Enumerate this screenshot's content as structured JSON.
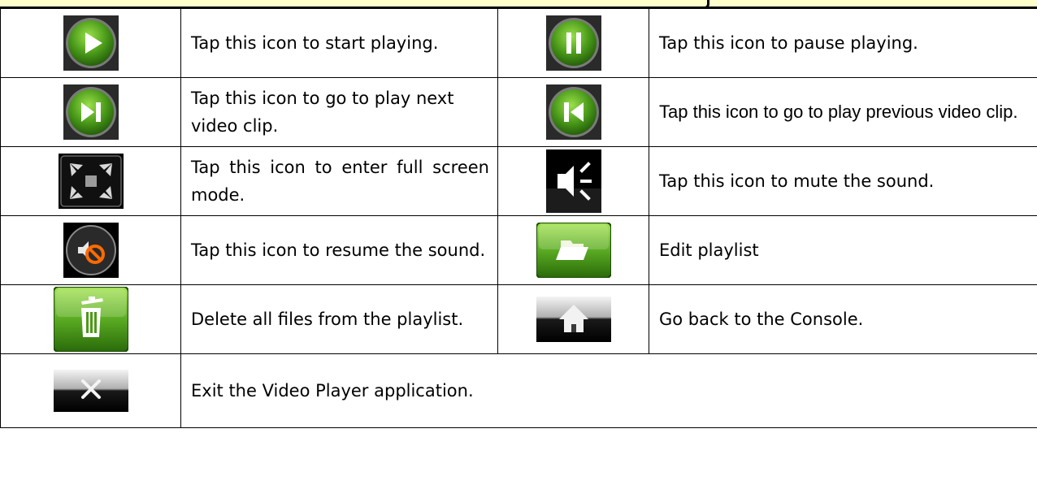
{
  "rows": [
    {
      "left": {
        "icon": "play-icon",
        "text": "Tap this icon to start playing."
      },
      "right": {
        "icon": "pause-icon",
        "text": "Tap this icon to pause playing."
      }
    },
    {
      "left": {
        "icon": "next-clip-icon",
        "text": "Tap this icon to go to play next video clip."
      },
      "right": {
        "icon": "prev-clip-icon",
        "text": "Tap this icon to go to play previous video clip."
      }
    },
    {
      "left": {
        "icon": "fullscreen-icon",
        "text": "Tap this icon to enter full screen mode."
      },
      "right": {
        "icon": "mute-icon",
        "text": "Tap this icon to mute the sound."
      }
    },
    {
      "left": {
        "icon": "resume-sound-icon",
        "text": "Tap this icon to resume the sound."
      },
      "right": {
        "icon": "folder-icon",
        "text": "Edit playlist"
      }
    },
    {
      "left": {
        "icon": "trash-icon",
        "text": "Delete all files from the playlist."
      },
      "right": {
        "icon": "home-icon",
        "text": "Go back to the Console."
      }
    },
    {
      "left": {
        "icon": "close-icon",
        "text": "Exit the Video Player application."
      }
    }
  ],
  "colors": {
    "green_light": "#8fd13a",
    "green_dark": "#2e6e0c",
    "header_yellow": "#ffffcc"
  }
}
